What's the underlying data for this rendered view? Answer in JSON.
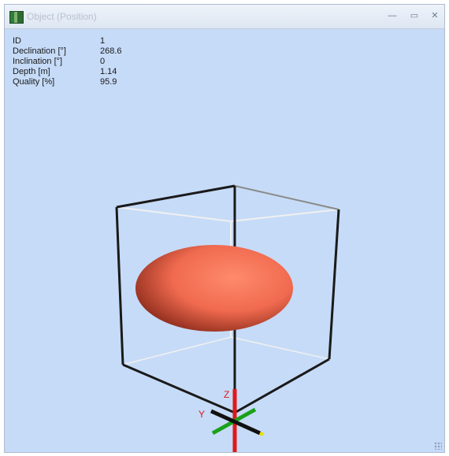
{
  "window": {
    "title": "Object (Position)",
    "minimize_icon": "minimize-icon",
    "maximize_icon": "restore-icon",
    "close_icon": "close-icon"
  },
  "info": {
    "rows": [
      {
        "label": "ID",
        "value": "1"
      },
      {
        "label": "Declination [°]",
        "value": "268.6"
      },
      {
        "label": "Inclination [°]",
        "value": "0"
      },
      {
        "label": "Depth [m]",
        "value": "1.14"
      },
      {
        "label": "Quality [%]",
        "value": "95.9"
      }
    ]
  },
  "scene": {
    "axis_z_label": "Z",
    "axis_y_label": "Y",
    "object_color": "#f06a4f",
    "background_color": "#c6dbf7",
    "axis_colors": {
      "z": "#e01818",
      "y": "#1aa11a",
      "x": "#111111"
    }
  }
}
